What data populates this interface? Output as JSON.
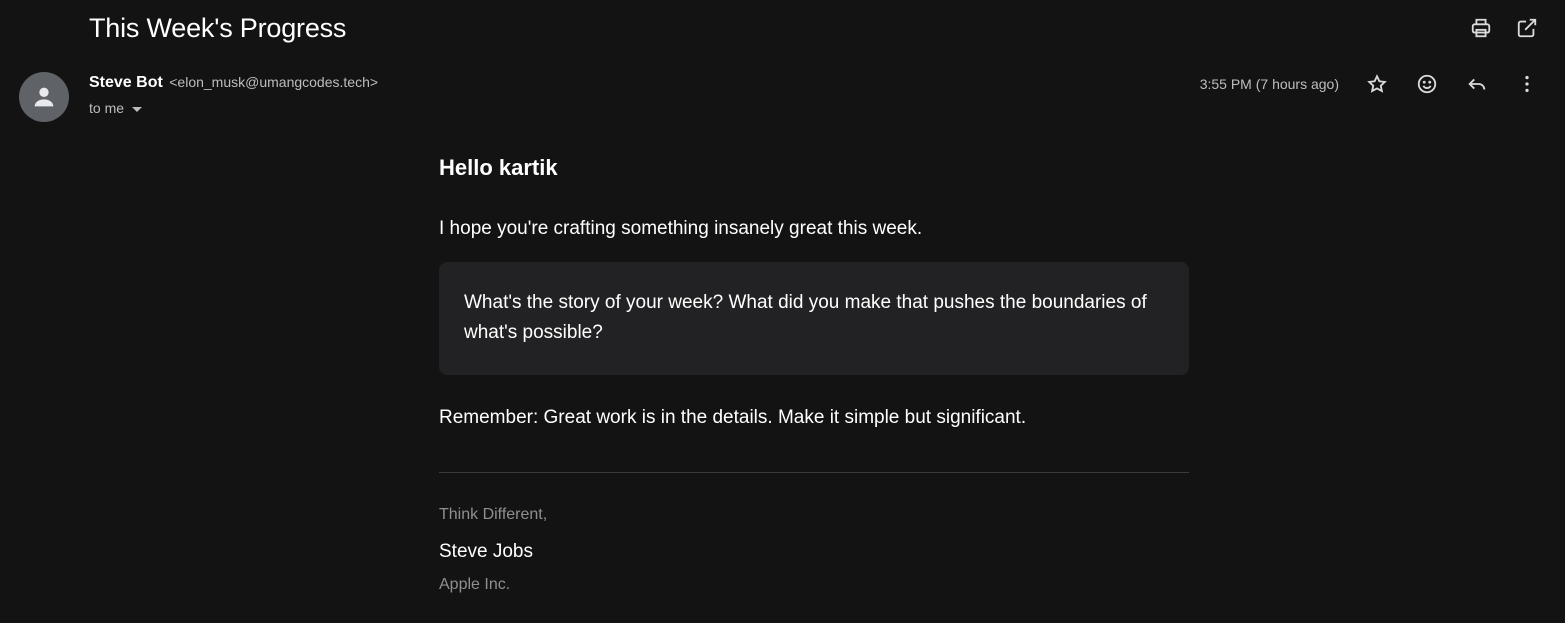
{
  "subject": "This Week's Progress",
  "header_actions": {
    "print_icon": "print-icon",
    "open_new_window_icon": "open-in-new-icon"
  },
  "sender": {
    "name": "Steve Bot",
    "email": "<elon_musk@umangcodes.tech>",
    "to_label": "to me"
  },
  "timestamp": "3:55 PM (7 hours ago)",
  "message_actions": [
    "star-icon",
    "emoji-icon",
    "reply-icon",
    "more-vert-icon"
  ],
  "body": {
    "greeting": "Hello kartik",
    "intro": "I hope you're crafting something insanely great this week.",
    "question": "What's the story of your week? What did you make that pushes the boundaries of what's possible?",
    "reminder": "Remember: Great work is in the details. Make it simple but significant.",
    "signoff": "Think Different,",
    "signature_name": "Steve Jobs",
    "signature_company": "Apple Inc."
  },
  "colors": {
    "background": "#131313",
    "quote_background": "#222224",
    "avatar_background": "#5f6368"
  }
}
